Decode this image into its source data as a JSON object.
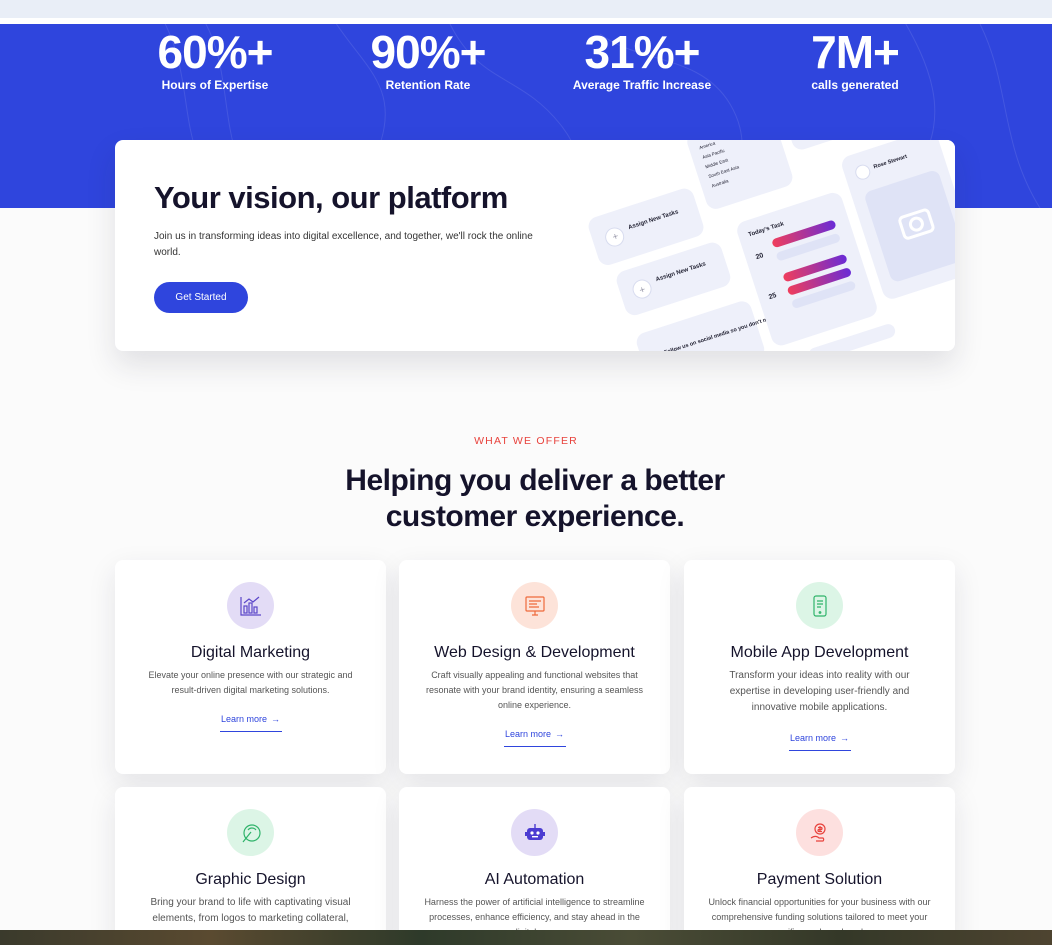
{
  "stats": [
    {
      "value": "60%+",
      "label": "Hours of Expertise"
    },
    {
      "value": "90%+",
      "label": "Retention Rate"
    },
    {
      "value": "31%+",
      "label": "Average Traffic Increase"
    },
    {
      "value": "7M+",
      "label": "calls generated"
    }
  ],
  "vision": {
    "title": "Your vision, our platform",
    "text": "Join us in transforming ideas into digital excellence, and together, we'll rock the online world.",
    "button": "Get Started"
  },
  "mockup": {
    "task1": "Assign New Tasks",
    "task2": "Assign New Tasks",
    "quote": "Hey! Follow us on social media so you don't miss any offer.",
    "today": "Today's Task",
    "day1": "20",
    "day2": "25",
    "profile": "Rose Stewart",
    "countries": [
      "America",
      "Asia Pacific",
      "Middle East",
      "South East Asia",
      "Australia"
    ]
  },
  "offer": {
    "eyebrow": "WHAT WE OFFER",
    "title": "Helping you deliver a better customer experience."
  },
  "services": [
    {
      "title": "Digital Marketing",
      "desc": "Elevate your online presence with our strategic and result-driven digital marketing solutions.",
      "link": "Learn more",
      "icon": "chart-icon",
      "color": "#e3dcf6"
    },
    {
      "title": "Web Design & Development",
      "desc": "Craft visually appealing and functional websites that resonate with your brand identity, ensuring a seamless online experience.",
      "link": "Learn more",
      "icon": "monitor-icon",
      "color": "#fde3d9"
    },
    {
      "title": "Mobile App Development",
      "desc": "Transform your ideas into reality with our expertise in developing user-friendly and innovative mobile applications.",
      "link": "Learn more",
      "icon": "mobile-icon",
      "color": "#dcf5e6"
    },
    {
      "title": "Graphic Design",
      "desc": "Bring your brand to life with captivating visual elements, from logos to marketing collateral,",
      "icon": "palette-icon",
      "color": "#dcf5e6"
    },
    {
      "title": "AI Automation",
      "desc": "Harness the power of artificial intelligence to streamline processes, enhance efficiency, and stay ahead in the digital age.",
      "icon": "robot-icon",
      "color": "#e3dcf6"
    },
    {
      "title": "Payment Solution",
      "desc": "Unlock financial opportunities for your business with our comprehensive funding solutions tailored to meet your specific needs and goals.",
      "icon": "money-hand-icon",
      "color": "#fde0df"
    }
  ]
}
